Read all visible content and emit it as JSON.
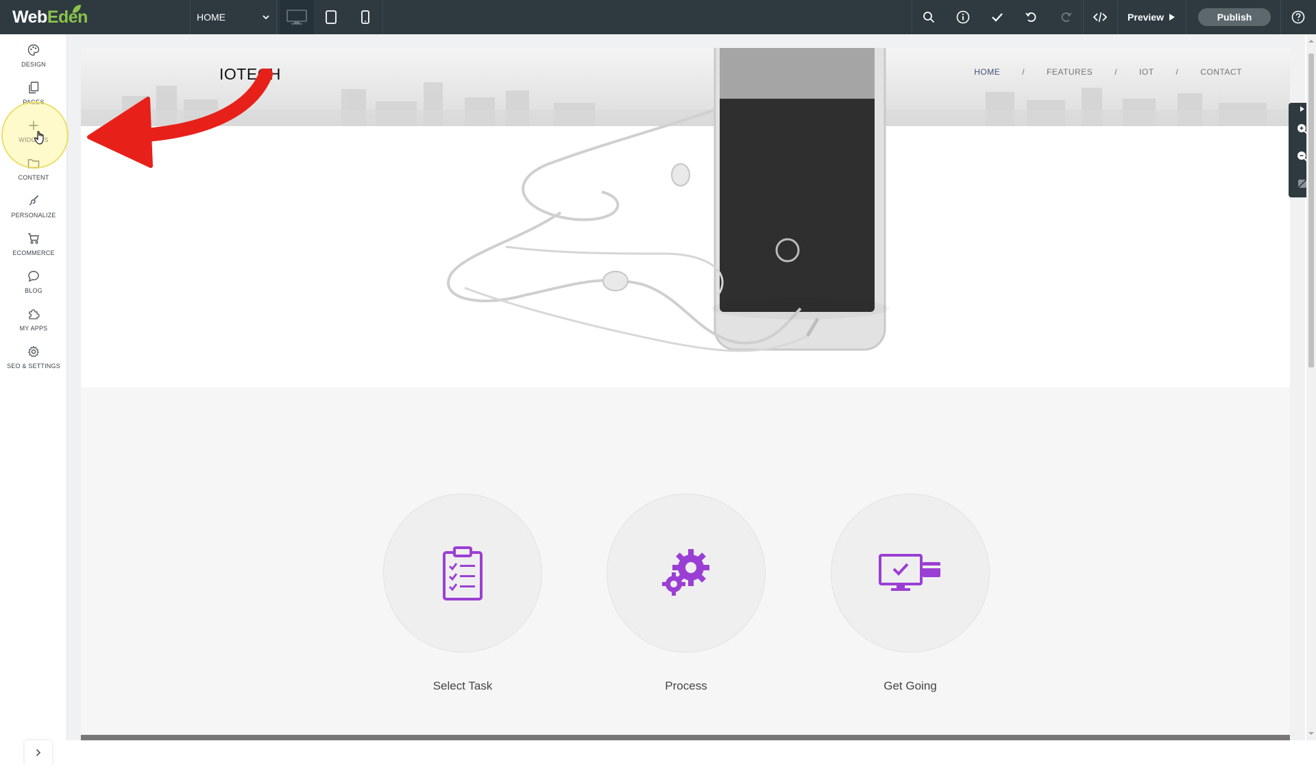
{
  "app": {
    "logo_part1": "Web",
    "logo_part2": "Eden"
  },
  "toolbar": {
    "page_select_value": "HOME",
    "preview_label": "Preview",
    "publish_label": "Publish",
    "icons": [
      "search-icon",
      "info-icon",
      "check-icon",
      "undo-icon",
      "redo-icon",
      "code-icon",
      "help-icon"
    ]
  },
  "sidebar": {
    "items": [
      {
        "label": "DESIGN",
        "icon": "palette-icon"
      },
      {
        "label": "PAGES",
        "icon": "pages-icon"
      },
      {
        "label": "WIDGETS",
        "icon": "plus-icon"
      },
      {
        "label": "CONTENT",
        "icon": "folder-icon"
      },
      {
        "label": "PERSONALIZE",
        "icon": "personalize-icon"
      },
      {
        "label": "ECOMMERCE",
        "icon": "cart-icon"
      },
      {
        "label": "BLOG",
        "icon": "chat-bubble-icon"
      },
      {
        "label": "MY APPS",
        "icon": "puzzle-icon"
      },
      {
        "label": "SEO & SETTINGS",
        "icon": "gear-icon"
      }
    ]
  },
  "site": {
    "brand": "IOTECH",
    "nav": [
      {
        "label": "HOME"
      },
      {
        "label": "FEATURES"
      },
      {
        "label": "IOT"
      },
      {
        "label": "CONTACT"
      }
    ],
    "nav_separator": "/",
    "features": [
      {
        "label": "Select Task",
        "icon": "clipboard-checklist-icon"
      },
      {
        "label": "Process",
        "icon": "gears-icon"
      },
      {
        "label": "Get Going",
        "icon": "monitor-card-icon"
      }
    ]
  },
  "colors": {
    "topbar": "#2e3a40",
    "accent_purple": "#9b3fd4",
    "logo_green": "#8bc34a",
    "annotation_red": "#e8201a",
    "highlight_yellow": "#fff58c"
  }
}
